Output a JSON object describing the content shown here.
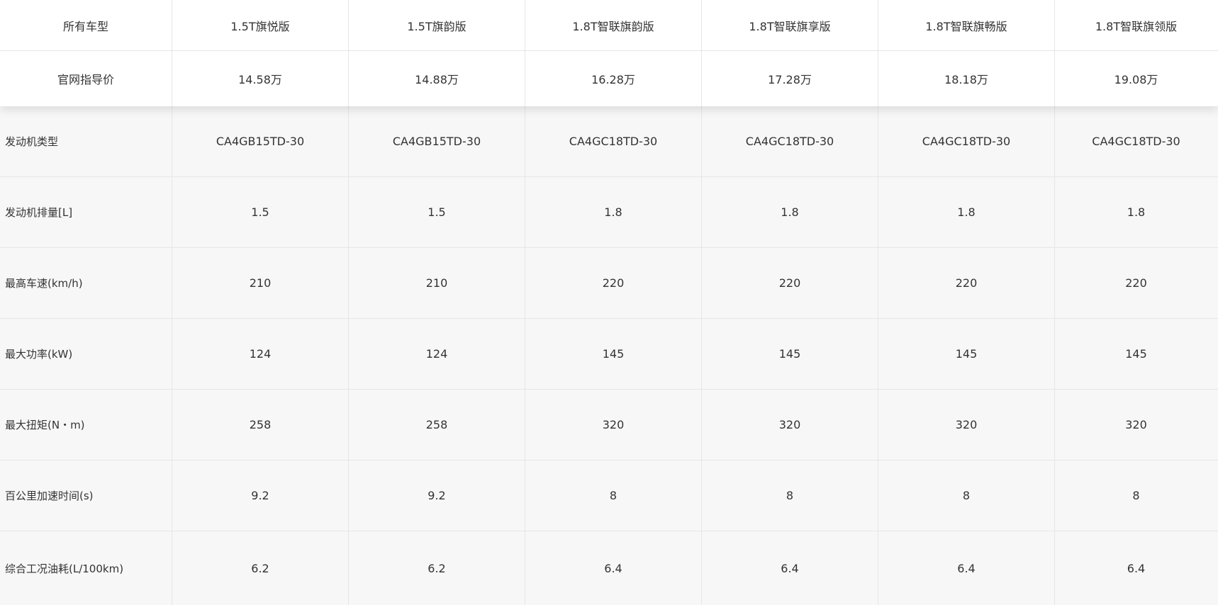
{
  "table": {
    "header_label": "所有车型",
    "models": [
      "1.5T旗悦版",
      "1.5T旗韵版",
      "1.8T智联旗韵版",
      "1.8T智联旗享版",
      "1.8T智联旗畅版",
      "1.8T智联旗领版"
    ],
    "price_label": "官网指导价",
    "prices": [
      "14.58万",
      "14.88万",
      "16.28万",
      "17.28万",
      "18.18万",
      "19.08万"
    ],
    "rows": [
      {
        "label": "发动机类型",
        "values": [
          "CA4GB15TD-30",
          "CA4GB15TD-30",
          "CA4GC18TD-30",
          "CA4GC18TD-30",
          "CA4GC18TD-30",
          "CA4GC18TD-30"
        ]
      },
      {
        "label": "发动机排量[L]",
        "values": [
          "1.5",
          "1.5",
          "1.8",
          "1.8",
          "1.8",
          "1.8"
        ]
      },
      {
        "label": "最高车速(km/h)",
        "values": [
          "210",
          "210",
          "220",
          "220",
          "220",
          "220"
        ]
      },
      {
        "label": "最大功率(kW)",
        "values": [
          "124",
          "124",
          "145",
          "145",
          "145",
          "145"
        ]
      },
      {
        "label": "最大扭矩(N・m)",
        "values": [
          "258",
          "258",
          "320",
          "320",
          "320",
          "320"
        ]
      },
      {
        "label": "百公里加速时间(s)",
        "values": [
          "9.2",
          "9.2",
          "8",
          "8",
          "8",
          "8"
        ]
      },
      {
        "label": "综合工况油耗(L/100km)",
        "values": [
          "6.2",
          "6.2",
          "6.4",
          "6.4",
          "6.4",
          "6.4"
        ]
      }
    ]
  }
}
